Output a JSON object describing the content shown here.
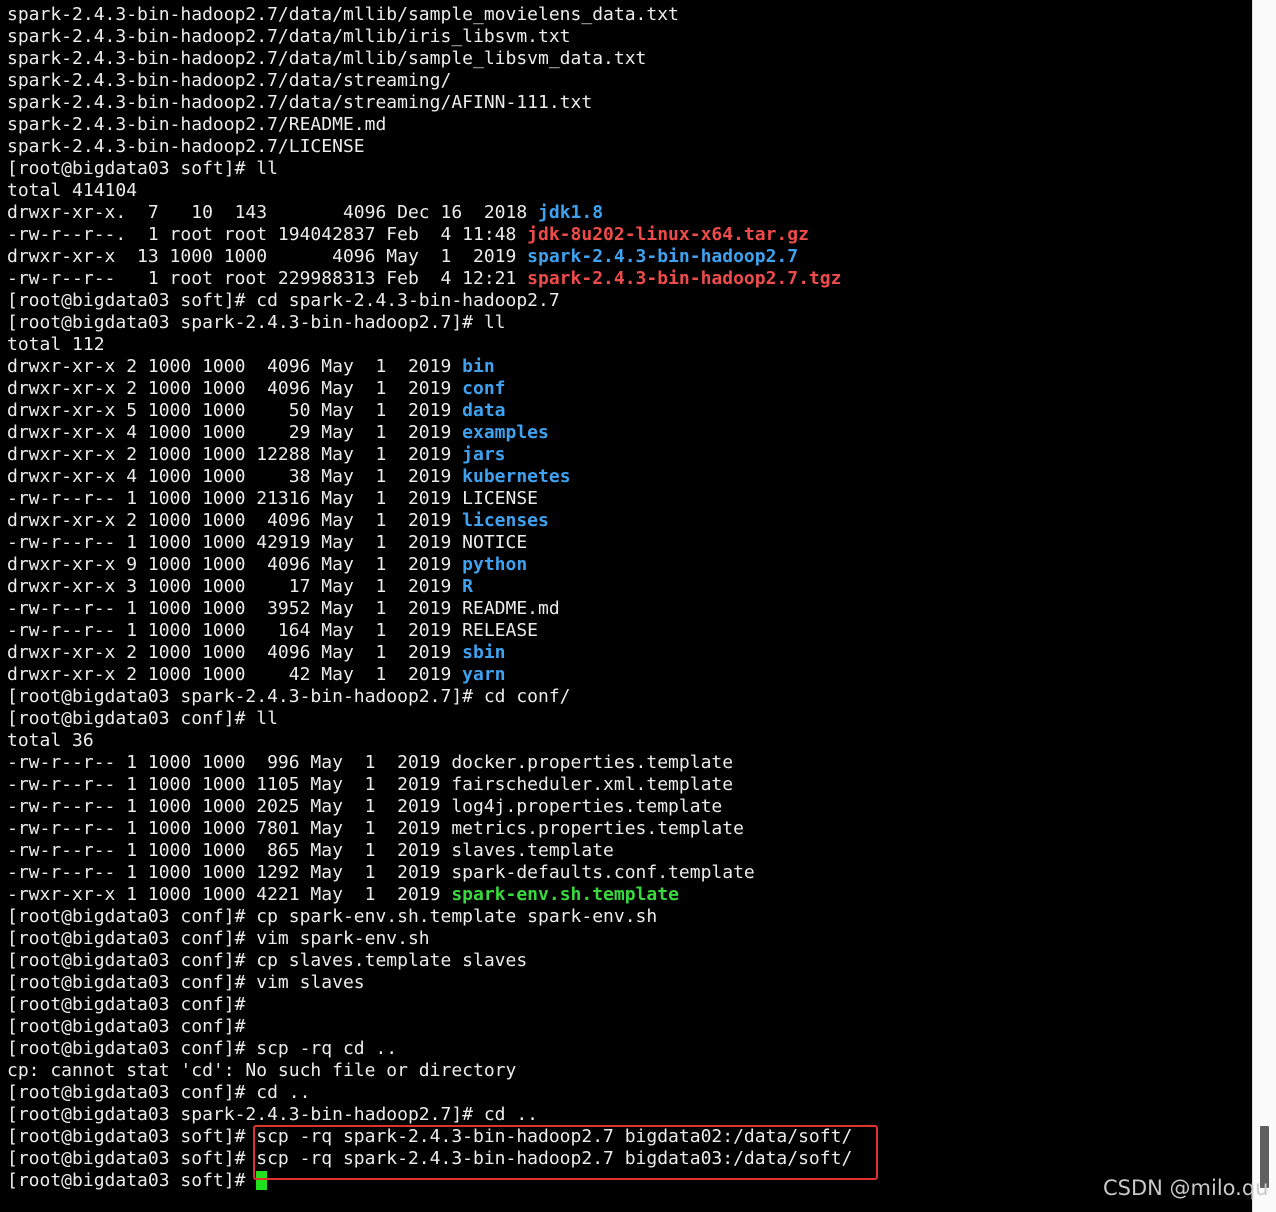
{
  "terminal": {
    "lines": [
      [
        {
          "t": "spark-2.4.3-bin-hadoop2.7/data/mllib/sample_movielens_data.txt"
        }
      ],
      [
        {
          "t": "spark-2.4.3-bin-hadoop2.7/data/mllib/iris_libsvm.txt"
        }
      ],
      [
        {
          "t": "spark-2.4.3-bin-hadoop2.7/data/mllib/sample_libsvm_data.txt"
        }
      ],
      [
        {
          "t": "spark-2.4.3-bin-hadoop2.7/data/streaming/"
        }
      ],
      [
        {
          "t": "spark-2.4.3-bin-hadoop2.7/data/streaming/AFINN-111.txt"
        }
      ],
      [
        {
          "t": "spark-2.4.3-bin-hadoop2.7/README.md"
        }
      ],
      [
        {
          "t": "spark-2.4.3-bin-hadoop2.7/LICENSE"
        }
      ],
      [
        {
          "t": "[root@bigdata03 soft]# ll"
        }
      ],
      [
        {
          "t": "total 414104"
        }
      ],
      [
        {
          "t": "drwxr-xr-x.  7   10  143       4096 Dec 16  2018 "
        },
        {
          "t": "jdk1.8",
          "c": "dir"
        }
      ],
      [
        {
          "t": "-rw-r--r--.  1 root root 194042837 Feb  4 11:48 "
        },
        {
          "t": "jdk-8u202-linux-x64.tar.gz",
          "c": "arch"
        }
      ],
      [
        {
          "t": "drwxr-xr-x  13 1000 1000      4096 May  1  2019 "
        },
        {
          "t": "spark-2.4.3-bin-hadoop2.7",
          "c": "dir"
        }
      ],
      [
        {
          "t": "-rw-r--r--   1 root root 229988313 Feb  4 12:21 "
        },
        {
          "t": "spark-2.4.3-bin-hadoop2.7.tgz",
          "c": "arch"
        }
      ],
      [
        {
          "t": "[root@bigdata03 soft]# cd spark-2.4.3-bin-hadoop2.7"
        }
      ],
      [
        {
          "t": "[root@bigdata03 spark-2.4.3-bin-hadoop2.7]# ll"
        }
      ],
      [
        {
          "t": "total 112"
        }
      ],
      [
        {
          "t": "drwxr-xr-x 2 1000 1000  4096 May  1  2019 "
        },
        {
          "t": "bin",
          "c": "dir"
        }
      ],
      [
        {
          "t": "drwxr-xr-x 2 1000 1000  4096 May  1  2019 "
        },
        {
          "t": "conf",
          "c": "dir"
        }
      ],
      [
        {
          "t": "drwxr-xr-x 5 1000 1000    50 May  1  2019 "
        },
        {
          "t": "data",
          "c": "dir"
        }
      ],
      [
        {
          "t": "drwxr-xr-x 4 1000 1000    29 May  1  2019 "
        },
        {
          "t": "examples",
          "c": "dir"
        }
      ],
      [
        {
          "t": "drwxr-xr-x 2 1000 1000 12288 May  1  2019 "
        },
        {
          "t": "jars",
          "c": "dir"
        }
      ],
      [
        {
          "t": "drwxr-xr-x 4 1000 1000    38 May  1  2019 "
        },
        {
          "t": "kubernetes",
          "c": "dir"
        }
      ],
      [
        {
          "t": "-rw-r--r-- 1 1000 1000 21316 May  1  2019 LICENSE"
        }
      ],
      [
        {
          "t": "drwxr-xr-x 2 1000 1000  4096 May  1  2019 "
        },
        {
          "t": "licenses",
          "c": "dir"
        }
      ],
      [
        {
          "t": "-rw-r--r-- 1 1000 1000 42919 May  1  2019 NOTICE"
        }
      ],
      [
        {
          "t": "drwxr-xr-x 9 1000 1000  4096 May  1  2019 "
        },
        {
          "t": "python",
          "c": "dir"
        }
      ],
      [
        {
          "t": "drwxr-xr-x 3 1000 1000    17 May  1  2019 "
        },
        {
          "t": "R",
          "c": "dir"
        }
      ],
      [
        {
          "t": "-rw-r--r-- 1 1000 1000  3952 May  1  2019 README.md"
        }
      ],
      [
        {
          "t": "-rw-r--r-- 1 1000 1000   164 May  1  2019 RELEASE"
        }
      ],
      [
        {
          "t": "drwxr-xr-x 2 1000 1000  4096 May  1  2019 "
        },
        {
          "t": "sbin",
          "c": "dir"
        }
      ],
      [
        {
          "t": "drwxr-xr-x 2 1000 1000    42 May  1  2019 "
        },
        {
          "t": "yarn",
          "c": "dir"
        }
      ],
      [
        {
          "t": "[root@bigdata03 spark-2.4.3-bin-hadoop2.7]# cd conf/"
        }
      ],
      [
        {
          "t": "[root@bigdata03 conf]# ll"
        }
      ],
      [
        {
          "t": "total 36"
        }
      ],
      [
        {
          "t": "-rw-r--r-- 1 1000 1000  996 May  1  2019 docker.properties.template"
        }
      ],
      [
        {
          "t": "-rw-r--r-- 1 1000 1000 1105 May  1  2019 fairscheduler.xml.template"
        }
      ],
      [
        {
          "t": "-rw-r--r-- 1 1000 1000 2025 May  1  2019 log4j.properties.template"
        }
      ],
      [
        {
          "t": "-rw-r--r-- 1 1000 1000 7801 May  1  2019 metrics.properties.template"
        }
      ],
      [
        {
          "t": "-rw-r--r-- 1 1000 1000  865 May  1  2019 slaves.template"
        }
      ],
      [
        {
          "t": "-rw-r--r-- 1 1000 1000 1292 May  1  2019 spark-defaults.conf.template"
        }
      ],
      [
        {
          "t": "-rwxr-xr-x 1 1000 1000 4221 May  1  2019 "
        },
        {
          "t": "spark-env.sh.template",
          "c": "exec"
        }
      ],
      [
        {
          "t": "[root@bigdata03 conf]# cp spark-env.sh.template spark-env.sh"
        }
      ],
      [
        {
          "t": "[root@bigdata03 conf]# vim spark-env.sh"
        }
      ],
      [
        {
          "t": "[root@bigdata03 conf]# cp slaves.template slaves"
        }
      ],
      [
        {
          "t": "[root@bigdata03 conf]# vim slaves"
        }
      ],
      [
        {
          "t": "[root@bigdata03 conf]#"
        }
      ],
      [
        {
          "t": "[root@bigdata03 conf]#"
        }
      ],
      [
        {
          "t": "[root@bigdata03 conf]# scp -rq cd .."
        }
      ],
      [
        {
          "t": "cp: cannot stat 'cd': No such file or directory"
        }
      ],
      [
        {
          "t": "[root@bigdata03 conf]# cd .."
        }
      ],
      [
        {
          "t": "[root@bigdata03 spark-2.4.3-bin-hadoop2.7]# cd .."
        }
      ],
      [
        {
          "t": "[root@bigdata03 soft]# scp -rq spark-2.4.3-bin-hadoop2.7 bigdata02:/data/soft/"
        }
      ],
      [
        {
          "t": "[root@bigdata03 soft]# scp -rq spark-2.4.3-bin-hadoop2.7 bigdata03:/data/soft/"
        }
      ],
      [
        {
          "t": "[root@bigdata03 soft]# "
        }
      ]
    ]
  },
  "watermark": "CSDN @milo.qu",
  "colors": {
    "background": "#000000",
    "text": "#ececec",
    "directory": "#3ea2f0",
    "archive": "#ef4b4b",
    "executable": "#39d83c",
    "cursor": "#20e020",
    "highlight_box": "#e0322c"
  }
}
